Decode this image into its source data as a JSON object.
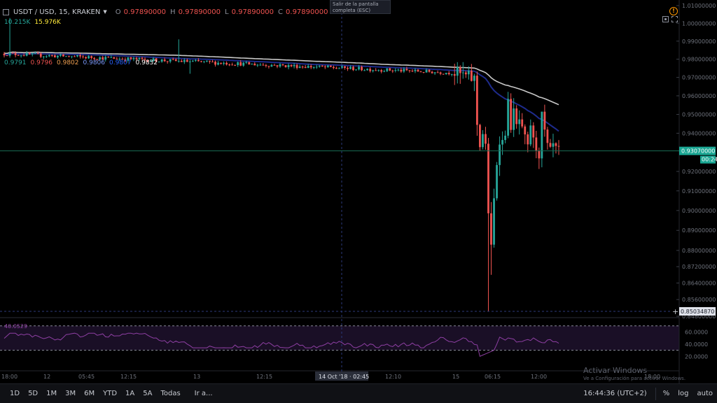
{
  "header": {
    "symbol": "USDT / USD, 15, KRAKEN",
    "ohlc": [
      {
        "key": "O",
        "value": "0.97890000"
      },
      {
        "key": "H",
        "value": "0.97890000"
      },
      {
        "key": "L",
        "value": "0.97890000"
      },
      {
        "key": "C",
        "value": "0.97890000"
      }
    ]
  },
  "volume": {
    "v1": "10.215K",
    "v2": "15.976K"
  },
  "ma_values": [
    "0.9791",
    "0.9796",
    "0.9802",
    "0.9806",
    "0.9807",
    "0.9832"
  ],
  "ma_colors": [
    "#26a69a",
    "#ef5350",
    "#f0a050",
    "#7e9cff",
    "#2962ff",
    "#ffffff"
  ],
  "tooltip": {
    "line1": "Salir de la pantalla",
    "line2": "completa (ESC)"
  },
  "colors": {
    "up": "#26a69a",
    "down": "#ef5350",
    "ma_slow": "#c8c8c8",
    "ma_fast": "#1e2b8c",
    "rsi_line": "#8e3fa3",
    "rsi_band": "#1a0f26",
    "price_label_bg": "#1aa693",
    "last_line": "#1a6b55"
  },
  "chart_data": {
    "type": "candlestick",
    "price_axis": {
      "ticks": [
        "1.01000000",
        "1.00000000",
        "0.99000000",
        "0.98000000",
        "0.97000000",
        "0.96000000",
        "0.95000000",
        "0.94000000",
        "0.92000000",
        "0.91000000",
        "0.90000000",
        "0.89000000",
        "0.88000000",
        "0.87200000",
        "0.86400000",
        "0.85600000",
        "0.84800000"
      ],
      "current_price": "0.93070000",
      "countdown": "00:24",
      "cursor_price": "0.85034870"
    },
    "time_axis": {
      "ticks": [
        "18:00",
        "12",
        "05:45",
        "12:15",
        "13",
        "12:15",
        "12:10",
        "15",
        "06:15",
        "12:00",
        "18:00"
      ],
      "cursor_label": "14 Oct '18 · 02:45"
    },
    "rsi": {
      "value": "40.0529",
      "ticks": [
        "60.0000",
        "40.0000",
        "20.0000"
      ],
      "upper": 70,
      "lower": 30
    }
  },
  "bottom_bar": {
    "ranges": [
      "1D",
      "5D",
      "1M",
      "3M",
      "6M",
      "YTD",
      "1A",
      "5A",
      "Todas"
    ],
    "goto": "Ir a...",
    "clock": "16:44:36 (UTC+2)",
    "percent": "%",
    "log": "log",
    "auto": "auto"
  },
  "watermark": {
    "title": "Activar Windows",
    "subtitle": "Ve a Configuración para activar Windows."
  }
}
